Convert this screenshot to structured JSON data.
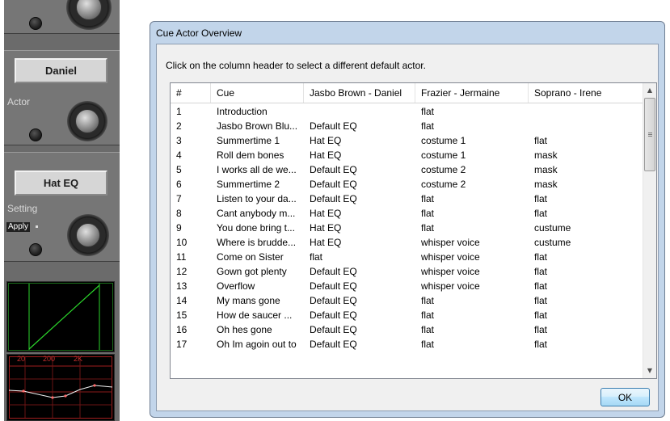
{
  "strip": {
    "actor_button": "Daniel",
    "actor_label": "Actor",
    "setting_button": "Hat EQ",
    "setting_label": "Setting",
    "apply_label": "Apply",
    "eq_ticks": [
      "20",
      "200",
      "2K"
    ]
  },
  "dialog": {
    "title": "Cue Actor Overview",
    "hint": "Click on the column header to select a different default actor.",
    "ok_label": "OK",
    "columns": [
      "#",
      "Cue",
      "Jasbo Brown - Daniel",
      "Frazier - Jermaine",
      "Soprano - Irene"
    ],
    "rows": [
      [
        "1",
        "Introduction",
        "",
        "flat",
        ""
      ],
      [
        "2",
        "Jasbo Brown Blu...",
        "Default EQ",
        "flat",
        ""
      ],
      [
        "3",
        "Summertime 1",
        "Hat EQ",
        "costume 1",
        "flat"
      ],
      [
        "4",
        "Roll dem bones",
        "Hat EQ",
        "costume 1",
        "mask"
      ],
      [
        "5",
        "I works all de we...",
        "Default EQ",
        "costume 2",
        "mask"
      ],
      [
        "6",
        "Summertime 2",
        "Default EQ",
        "costume 2",
        "mask"
      ],
      [
        "7",
        "Listen to your da...",
        "Default EQ",
        "flat",
        "flat"
      ],
      [
        "8",
        "Cant anybody m...",
        "Hat EQ",
        "flat",
        "flat"
      ],
      [
        "9",
        "You done bring t...",
        "Hat EQ",
        "flat",
        "custume"
      ],
      [
        "10",
        "Where is brudde...",
        "Hat EQ",
        "whisper voice",
        "custume"
      ],
      [
        "11",
        "Come on Sister",
        "flat",
        "whisper voice",
        "flat"
      ],
      [
        "12",
        "Gown got plenty",
        "Default EQ",
        "whisper voice",
        "flat"
      ],
      [
        "13",
        "Overflow",
        "Default EQ",
        "whisper voice",
        "flat"
      ],
      [
        "14",
        "My mans gone",
        "Default EQ",
        "flat",
        "flat"
      ],
      [
        "15",
        "How de saucer ...",
        "Default EQ",
        "flat",
        "flat"
      ],
      [
        "16",
        "Oh hes gone",
        "Default EQ",
        "flat",
        "flat"
      ],
      [
        "17",
        "Oh Im agoin out to",
        "Default EQ",
        "flat",
        "flat"
      ]
    ]
  },
  "colors": {
    "dialog_frame": "#c2d5ea",
    "client_bg": "#f0f0f0",
    "strip_bg": "#6b6b6b",
    "graph_line": "#2bd42b",
    "eq_grid": "#c23030"
  }
}
